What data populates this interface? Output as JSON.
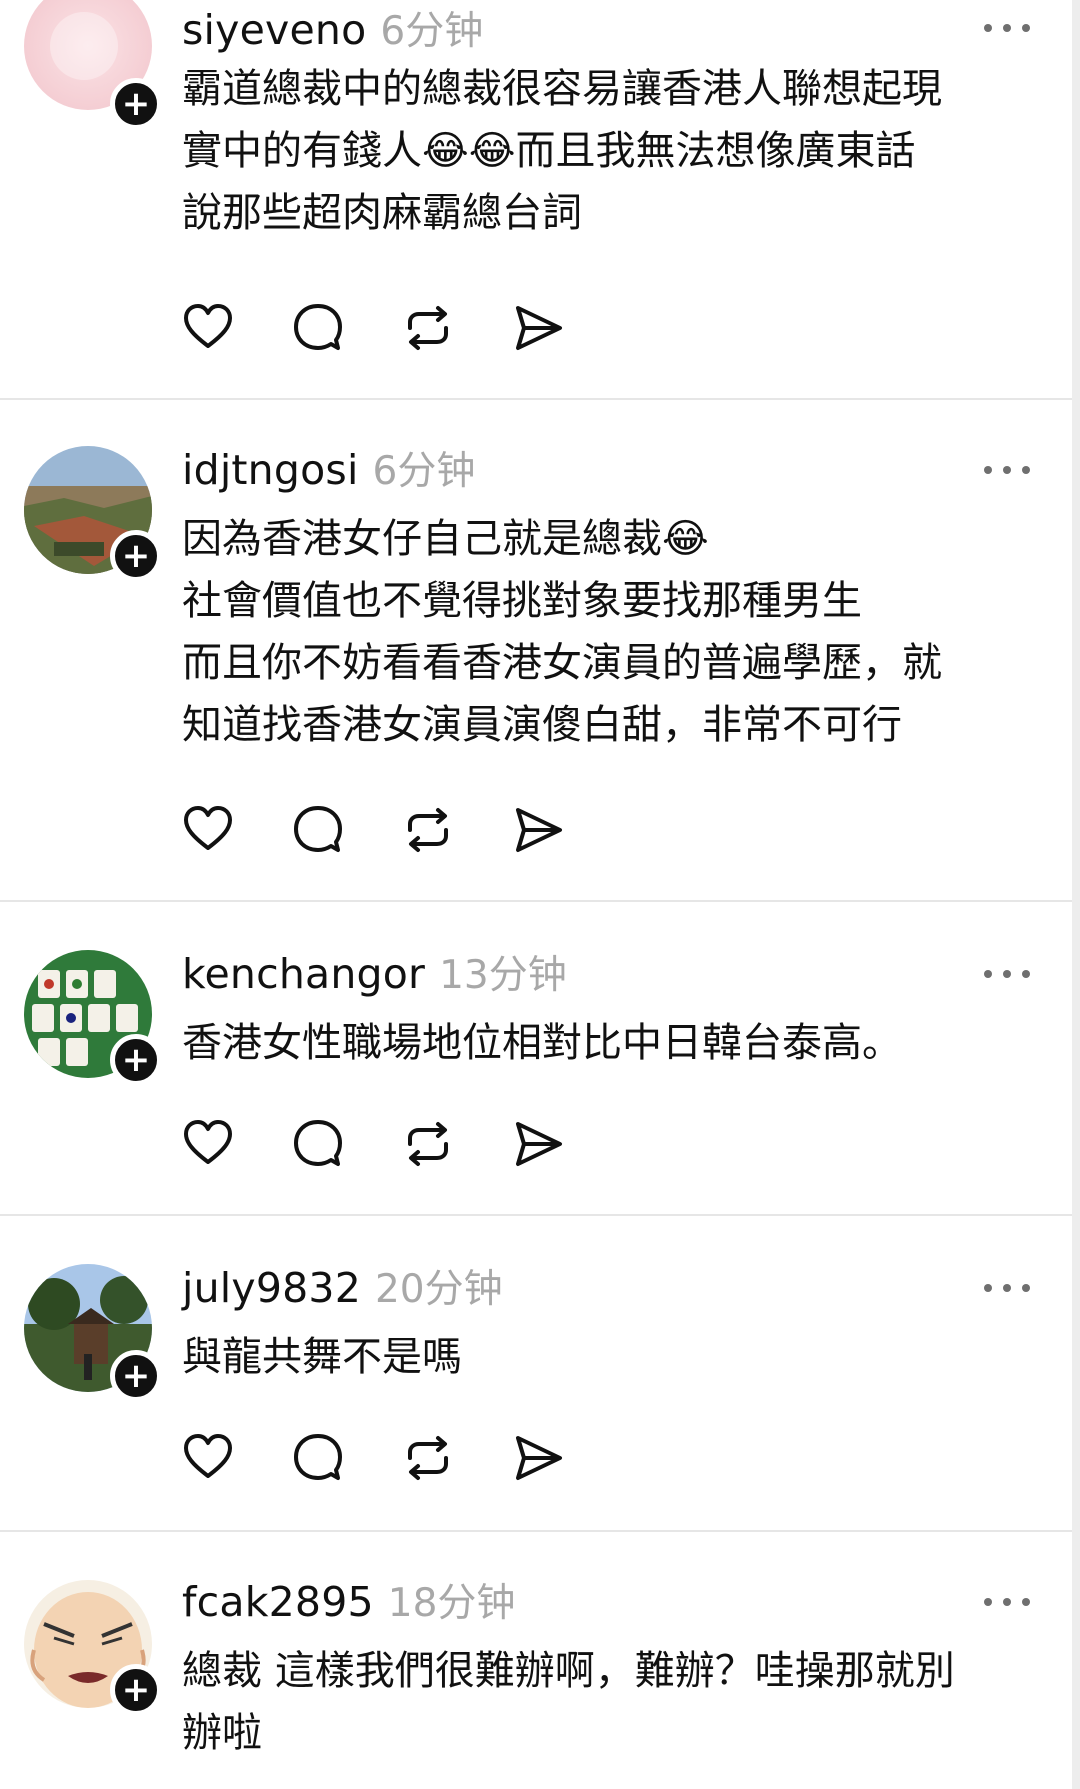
{
  "colors": {
    "text": "#111111",
    "time": "#a8a8a8",
    "divider": "#e6e6e6",
    "follow_badge": "#111111",
    "background": "#ffffff"
  },
  "icons": {
    "follow": "plus-icon",
    "more": "more-dots-icon",
    "like": "heart-icon",
    "comment": "comment-bubble-icon",
    "repost": "repost-arrows-icon",
    "share": "send-arrow-icon",
    "emoji": "laughing-tears-emoji"
  },
  "follow_label": "+",
  "comments": [
    {
      "username": "siyeveno",
      "time": "6分钟",
      "text": "霸道總裁中的總裁很容易讓香港人聯想起現\n實中的有錢人😂😂而且我無法想像廣東話\n說那些超肉麻霸總台詞"
    },
    {
      "username": "idjtngosi",
      "time": "6分钟",
      "text": "因為香港女仔自己就是總裁😂\n社會價值也不覺得挑對象要找那種男生\n而且你不妨看看香港女演員的普遍學歷，就\n知道找香港女演員演傻白甜，非常不可行"
    },
    {
      "username": "kenchangor",
      "time": "13分钟",
      "text": "香港女性職場地位相對比中日韓台泰高。"
    },
    {
      "username": "july9832",
      "time": "20分钟",
      "text": "與龍共舞不是嗎"
    },
    {
      "username": "fcak2895",
      "time": "18分钟",
      "text": "總裁 這樣我們很難辦啊，難辦？哇操那就別\n辦啦"
    }
  ]
}
